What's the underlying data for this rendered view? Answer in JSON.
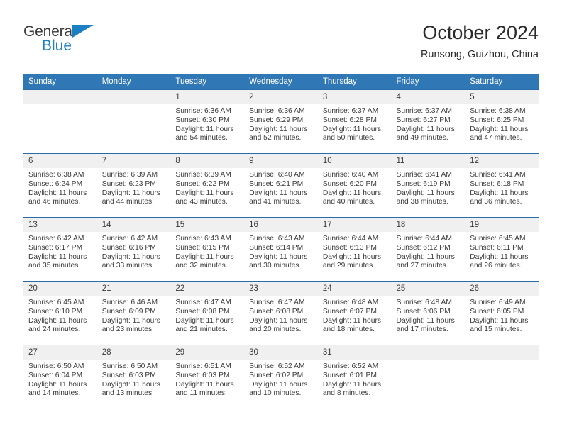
{
  "logo": {
    "word_one": "General",
    "word_two": "Blue",
    "triangle_icon": "triangle-icon",
    "brand_color": "#1b7fc4"
  },
  "header": {
    "title": "October 2024",
    "location": "Runsong, Guizhou, China"
  },
  "theme": {
    "header_blue": "#3077b5",
    "row_divider_blue": "#2b6ca8",
    "daynum_band": "#f0f0f0",
    "text": "#3a3a3a"
  },
  "calendar": {
    "weekday_headers": [
      "Sunday",
      "Monday",
      "Tuesday",
      "Wednesday",
      "Thursday",
      "Friday",
      "Saturday"
    ],
    "weeks": [
      [
        {
          "day": "",
          "sunrise": "",
          "sunset": "",
          "daylight_line1": "",
          "daylight_line2": "",
          "blank": true
        },
        {
          "day": "",
          "sunrise": "",
          "sunset": "",
          "daylight_line1": "",
          "daylight_line2": "",
          "blank": true
        },
        {
          "day": "1",
          "sunrise": "Sunrise: 6:36 AM",
          "sunset": "Sunset: 6:30 PM",
          "daylight_line1": "Daylight: 11 hours",
          "daylight_line2": "and 54 minutes.",
          "blank": false
        },
        {
          "day": "2",
          "sunrise": "Sunrise: 6:36 AM",
          "sunset": "Sunset: 6:29 PM",
          "daylight_line1": "Daylight: 11 hours",
          "daylight_line2": "and 52 minutes.",
          "blank": false
        },
        {
          "day": "3",
          "sunrise": "Sunrise: 6:37 AM",
          "sunset": "Sunset: 6:28 PM",
          "daylight_line1": "Daylight: 11 hours",
          "daylight_line2": "and 50 minutes.",
          "blank": false
        },
        {
          "day": "4",
          "sunrise": "Sunrise: 6:37 AM",
          "sunset": "Sunset: 6:27 PM",
          "daylight_line1": "Daylight: 11 hours",
          "daylight_line2": "and 49 minutes.",
          "blank": false
        },
        {
          "day": "5",
          "sunrise": "Sunrise: 6:38 AM",
          "sunset": "Sunset: 6:25 PM",
          "daylight_line1": "Daylight: 11 hours",
          "daylight_line2": "and 47 minutes.",
          "blank": false
        }
      ],
      [
        {
          "day": "6",
          "sunrise": "Sunrise: 6:38 AM",
          "sunset": "Sunset: 6:24 PM",
          "daylight_line1": "Daylight: 11 hours",
          "daylight_line2": "and 46 minutes.",
          "blank": false
        },
        {
          "day": "7",
          "sunrise": "Sunrise: 6:39 AM",
          "sunset": "Sunset: 6:23 PM",
          "daylight_line1": "Daylight: 11 hours",
          "daylight_line2": "and 44 minutes.",
          "blank": false
        },
        {
          "day": "8",
          "sunrise": "Sunrise: 6:39 AM",
          "sunset": "Sunset: 6:22 PM",
          "daylight_line1": "Daylight: 11 hours",
          "daylight_line2": "and 43 minutes.",
          "blank": false
        },
        {
          "day": "9",
          "sunrise": "Sunrise: 6:40 AM",
          "sunset": "Sunset: 6:21 PM",
          "daylight_line1": "Daylight: 11 hours",
          "daylight_line2": "and 41 minutes.",
          "blank": false
        },
        {
          "day": "10",
          "sunrise": "Sunrise: 6:40 AM",
          "sunset": "Sunset: 6:20 PM",
          "daylight_line1": "Daylight: 11 hours",
          "daylight_line2": "and 40 minutes.",
          "blank": false
        },
        {
          "day": "11",
          "sunrise": "Sunrise: 6:41 AM",
          "sunset": "Sunset: 6:19 PM",
          "daylight_line1": "Daylight: 11 hours",
          "daylight_line2": "and 38 minutes.",
          "blank": false
        },
        {
          "day": "12",
          "sunrise": "Sunrise: 6:41 AM",
          "sunset": "Sunset: 6:18 PM",
          "daylight_line1": "Daylight: 11 hours",
          "daylight_line2": "and 36 minutes.",
          "blank": false
        }
      ],
      [
        {
          "day": "13",
          "sunrise": "Sunrise: 6:42 AM",
          "sunset": "Sunset: 6:17 PM",
          "daylight_line1": "Daylight: 11 hours",
          "daylight_line2": "and 35 minutes.",
          "blank": false
        },
        {
          "day": "14",
          "sunrise": "Sunrise: 6:42 AM",
          "sunset": "Sunset: 6:16 PM",
          "daylight_line1": "Daylight: 11 hours",
          "daylight_line2": "and 33 minutes.",
          "blank": false
        },
        {
          "day": "15",
          "sunrise": "Sunrise: 6:43 AM",
          "sunset": "Sunset: 6:15 PM",
          "daylight_line1": "Daylight: 11 hours",
          "daylight_line2": "and 32 minutes.",
          "blank": false
        },
        {
          "day": "16",
          "sunrise": "Sunrise: 6:43 AM",
          "sunset": "Sunset: 6:14 PM",
          "daylight_line1": "Daylight: 11 hours",
          "daylight_line2": "and 30 minutes.",
          "blank": false
        },
        {
          "day": "17",
          "sunrise": "Sunrise: 6:44 AM",
          "sunset": "Sunset: 6:13 PM",
          "daylight_line1": "Daylight: 11 hours",
          "daylight_line2": "and 29 minutes.",
          "blank": false
        },
        {
          "day": "18",
          "sunrise": "Sunrise: 6:44 AM",
          "sunset": "Sunset: 6:12 PM",
          "daylight_line1": "Daylight: 11 hours",
          "daylight_line2": "and 27 minutes.",
          "blank": false
        },
        {
          "day": "19",
          "sunrise": "Sunrise: 6:45 AM",
          "sunset": "Sunset: 6:11 PM",
          "daylight_line1": "Daylight: 11 hours",
          "daylight_line2": "and 26 minutes.",
          "blank": false
        }
      ],
      [
        {
          "day": "20",
          "sunrise": "Sunrise: 6:45 AM",
          "sunset": "Sunset: 6:10 PM",
          "daylight_line1": "Daylight: 11 hours",
          "daylight_line2": "and 24 minutes.",
          "blank": false
        },
        {
          "day": "21",
          "sunrise": "Sunrise: 6:46 AM",
          "sunset": "Sunset: 6:09 PM",
          "daylight_line1": "Daylight: 11 hours",
          "daylight_line2": "and 23 minutes.",
          "blank": false
        },
        {
          "day": "22",
          "sunrise": "Sunrise: 6:47 AM",
          "sunset": "Sunset: 6:08 PM",
          "daylight_line1": "Daylight: 11 hours",
          "daylight_line2": "and 21 minutes.",
          "blank": false
        },
        {
          "day": "23",
          "sunrise": "Sunrise: 6:47 AM",
          "sunset": "Sunset: 6:08 PM",
          "daylight_line1": "Daylight: 11 hours",
          "daylight_line2": "and 20 minutes.",
          "blank": false
        },
        {
          "day": "24",
          "sunrise": "Sunrise: 6:48 AM",
          "sunset": "Sunset: 6:07 PM",
          "daylight_line1": "Daylight: 11 hours",
          "daylight_line2": "and 18 minutes.",
          "blank": false
        },
        {
          "day": "25",
          "sunrise": "Sunrise: 6:48 AM",
          "sunset": "Sunset: 6:06 PM",
          "daylight_line1": "Daylight: 11 hours",
          "daylight_line2": "and 17 minutes.",
          "blank": false
        },
        {
          "day": "26",
          "sunrise": "Sunrise: 6:49 AM",
          "sunset": "Sunset: 6:05 PM",
          "daylight_line1": "Daylight: 11 hours",
          "daylight_line2": "and 15 minutes.",
          "blank": false
        }
      ],
      [
        {
          "day": "27",
          "sunrise": "Sunrise: 6:50 AM",
          "sunset": "Sunset: 6:04 PM",
          "daylight_line1": "Daylight: 11 hours",
          "daylight_line2": "and 14 minutes.",
          "blank": false
        },
        {
          "day": "28",
          "sunrise": "Sunrise: 6:50 AM",
          "sunset": "Sunset: 6:03 PM",
          "daylight_line1": "Daylight: 11 hours",
          "daylight_line2": "and 13 minutes.",
          "blank": false
        },
        {
          "day": "29",
          "sunrise": "Sunrise: 6:51 AM",
          "sunset": "Sunset: 6:03 PM",
          "daylight_line1": "Daylight: 11 hours",
          "daylight_line2": "and 11 minutes.",
          "blank": false
        },
        {
          "day": "30",
          "sunrise": "Sunrise: 6:52 AM",
          "sunset": "Sunset: 6:02 PM",
          "daylight_line1": "Daylight: 11 hours",
          "daylight_line2": "and 10 minutes.",
          "blank": false
        },
        {
          "day": "31",
          "sunrise": "Sunrise: 6:52 AM",
          "sunset": "Sunset: 6:01 PM",
          "daylight_line1": "Daylight: 11 hours",
          "daylight_line2": "and 8 minutes.",
          "blank": false
        },
        {
          "day": "",
          "sunrise": "",
          "sunset": "",
          "daylight_line1": "",
          "daylight_line2": "",
          "blank": true
        },
        {
          "day": "",
          "sunrise": "",
          "sunset": "",
          "daylight_line1": "",
          "daylight_line2": "",
          "blank": true
        }
      ]
    ]
  }
}
